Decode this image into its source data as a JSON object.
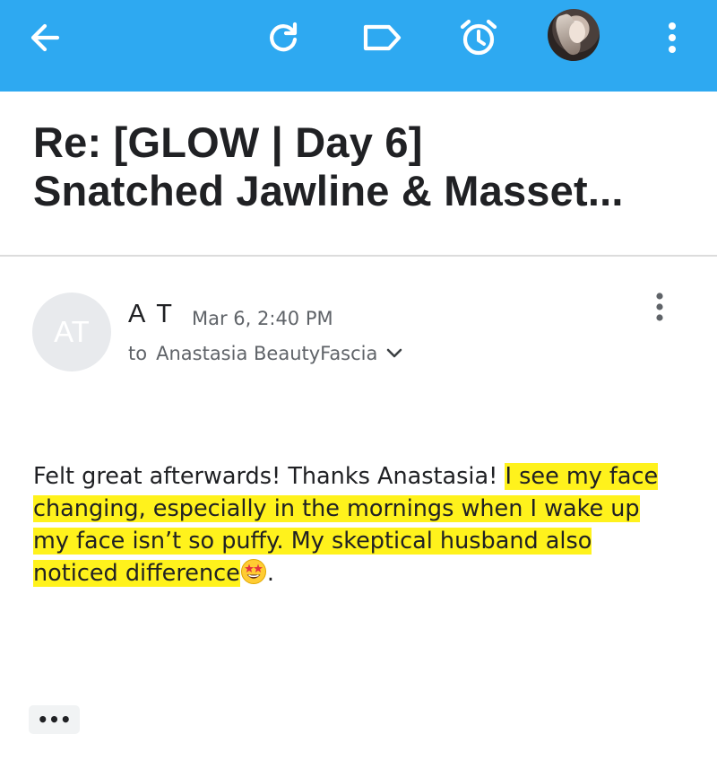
{
  "toolbar": {
    "icons": [
      "back-arrow-icon",
      "refresh-icon",
      "label-icon",
      "snooze-alarm-icon",
      "account-avatar",
      "more-vert-icon"
    ],
    "background": "#2ea9f1"
  },
  "email": {
    "subject_line1": "Re: [GLOW | Day 6]",
    "subject_line2": "Snatched Jawline & Masset...",
    "sender": {
      "initials": "AT",
      "name": "A T",
      "date": "Mar 6, 2:40 PM",
      "to_label": "to",
      "recipient": "Anastasia BeautyFascia"
    },
    "body": {
      "plain": "Felt great afterwards! Thanks Anastasia! ",
      "highlighted_1": "I see my face changing, especially in the mornings",
      "highlighted_2": " when I wake up my face isn’t so puffy. My skeptical husband also noticed difference",
      "emoji": "star-struck-emoji",
      "trailing": "."
    },
    "show_trimmed_label": "•••",
    "highlight_color": "#fff21c"
  }
}
